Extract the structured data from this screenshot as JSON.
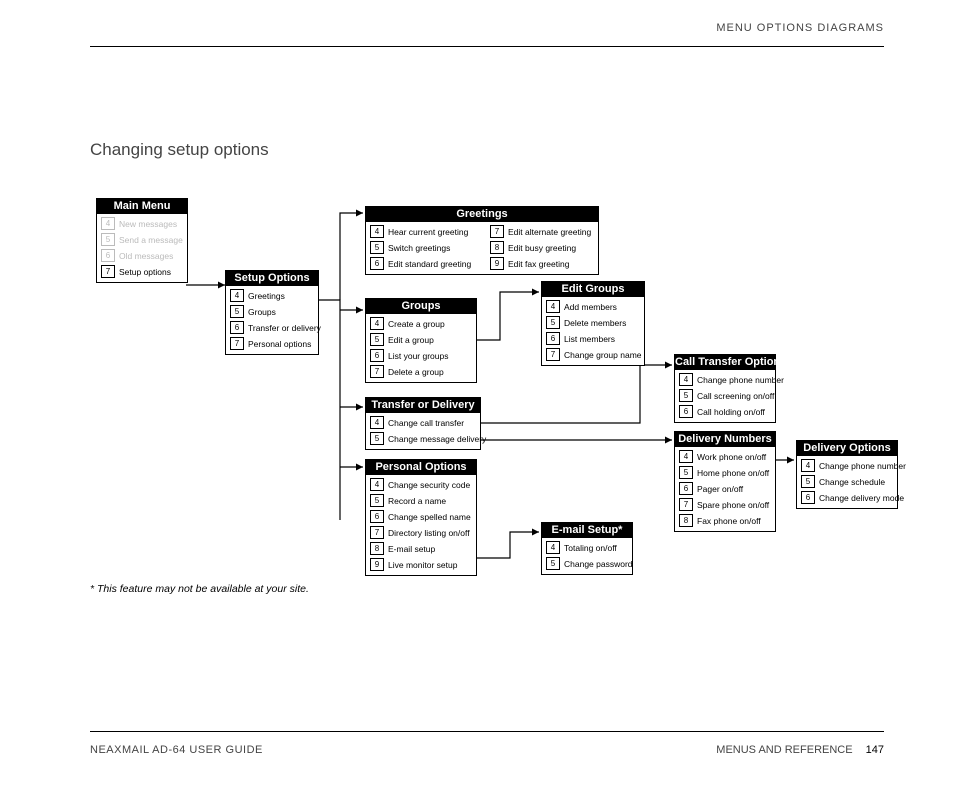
{
  "header": {
    "right": "MENU OPTIONS DIAGRAMS"
  },
  "title": "Changing setup options",
  "footer": {
    "left": "NEAXMAIL AD-64 USER GUIDE",
    "right_label": "MENUS AND REFERENCE",
    "page": "147"
  },
  "footnote": "* This feature may not be available at your site.",
  "boxes": {
    "main_menu": {
      "title": "Main Menu",
      "items": [
        {
          "k": "4",
          "t": "New messages",
          "dim": true
        },
        {
          "k": "5",
          "t": "Send a message",
          "dim": true
        },
        {
          "k": "6",
          "t": "Old messages",
          "dim": true
        },
        {
          "k": "7",
          "t": "Setup options",
          "dim": false
        }
      ]
    },
    "setup_options": {
      "title": "Setup Options",
      "items": [
        {
          "k": "4",
          "t": "Greetings"
        },
        {
          "k": "5",
          "t": "Groups"
        },
        {
          "k": "6",
          "t": "Transfer or delivery"
        },
        {
          "k": "7",
          "t": "Personal options"
        }
      ]
    },
    "greetings": {
      "title": "Greetings",
      "left": [
        {
          "k": "4",
          "t": "Hear current greeting"
        },
        {
          "k": "5",
          "t": "Switch greetings"
        },
        {
          "k": "6",
          "t": "Edit standard greeting"
        }
      ],
      "right": [
        {
          "k": "7",
          "t": "Edit alternate greeting"
        },
        {
          "k": "8",
          "t": "Edit busy greeting"
        },
        {
          "k": "9",
          "t": "Edit fax greeting"
        }
      ]
    },
    "groups": {
      "title": "Groups",
      "items": [
        {
          "k": "4",
          "t": "Create a group"
        },
        {
          "k": "5",
          "t": "Edit a group"
        },
        {
          "k": "6",
          "t": "List your groups"
        },
        {
          "k": "7",
          "t": "Delete a group"
        }
      ]
    },
    "edit_groups": {
      "title": "Edit Groups",
      "items": [
        {
          "k": "4",
          "t": "Add members"
        },
        {
          "k": "5",
          "t": "Delete members"
        },
        {
          "k": "6",
          "t": "List members"
        },
        {
          "k": "7",
          "t": "Change group name"
        }
      ]
    },
    "transfer_delivery": {
      "title": "Transfer or Delivery",
      "items": [
        {
          "k": "4",
          "t": "Change call transfer"
        },
        {
          "k": "5",
          "t": "Change message delivery"
        }
      ]
    },
    "call_transfer": {
      "title": "Call Transfer Options",
      "items": [
        {
          "k": "4",
          "t": "Change phone number"
        },
        {
          "k": "5",
          "t": "Call screening on/off"
        },
        {
          "k": "6",
          "t": "Call holding on/off"
        }
      ]
    },
    "delivery_numbers": {
      "title": "Delivery Numbers",
      "items": [
        {
          "k": "4",
          "t": "Work phone on/off"
        },
        {
          "k": "5",
          "t": "Home phone on/off"
        },
        {
          "k": "6",
          "t": "Pager on/off"
        },
        {
          "k": "7",
          "t": "Spare phone on/off"
        },
        {
          "k": "8",
          "t": "Fax phone on/off"
        }
      ]
    },
    "delivery_options": {
      "title": "Delivery Options",
      "items": [
        {
          "k": "4",
          "t": "Change phone number"
        },
        {
          "k": "5",
          "t": "Change schedule"
        },
        {
          "k": "6",
          "t": "Change delivery mode"
        }
      ]
    },
    "personal_options": {
      "title": "Personal Options",
      "items": [
        {
          "k": "4",
          "t": "Change security code"
        },
        {
          "k": "5",
          "t": "Record a name"
        },
        {
          "k": "6",
          "t": "Change spelled name"
        },
        {
          "k": "7",
          "t": "Directory listing on/off"
        },
        {
          "k": "8",
          "t": "E-mail setup"
        },
        {
          "k": "9",
          "t": "Live monitor setup"
        }
      ]
    },
    "email_setup": {
      "title": "E-mail Setup*",
      "items": [
        {
          "k": "4",
          "t": "Totaling on/off"
        },
        {
          "k": "5",
          "t": "Change password"
        }
      ]
    }
  }
}
